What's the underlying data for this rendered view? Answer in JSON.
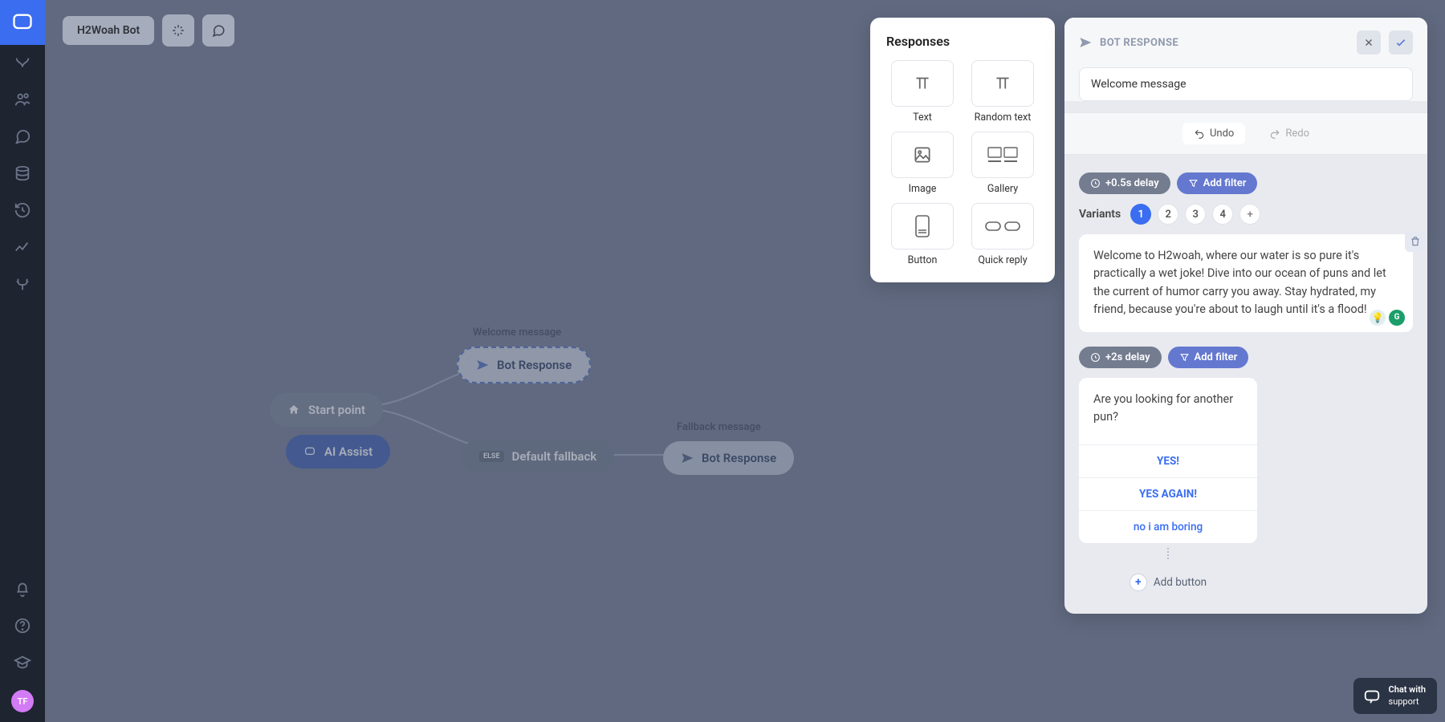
{
  "app": {
    "bot_name": "H2Woah Bot"
  },
  "sidebar": {
    "avatar_initials": "TF"
  },
  "canvas": {
    "start_label": "Start point",
    "ai_label": "AI Assist",
    "welcome_title": "Welcome message",
    "bot_response_label": "Bot Response",
    "fallback_title": "Fallback message",
    "default_fallback_label": "Default fallback",
    "else_badge": "ELSE"
  },
  "responses": {
    "title": "Responses",
    "items": {
      "text": "Text",
      "random_text": "Random text",
      "image": "Image",
      "gallery": "Gallery",
      "button": "Button",
      "quick_reply": "Quick reply"
    }
  },
  "panel": {
    "header_title": "BOT RESPONSE",
    "name_value": "Welcome message",
    "undo": "Undo",
    "redo": "Redo",
    "delay1": "+0.5s delay",
    "delay2": "+2s delay",
    "add_filter": "Add filter",
    "variants_label": "Variants",
    "variants": {
      "v1": "1",
      "v2": "2",
      "v3": "3",
      "v4": "4"
    },
    "message1": "Welcome to H2woah, where our water is so pure it's practically a wet joke! Dive into our ocean of puns and let the current of humor carry you away. Stay hydrated, my friend, because you're about to laugh until it's a flood!",
    "quick_text": "Are you looking for another pun?",
    "quick_btns": {
      "b1": "YES!",
      "b2": "YES AGAIN!",
      "b3": "no i am boring"
    },
    "add_button": "Add button"
  },
  "chat_widget": {
    "line1": "Chat with",
    "line2": "support"
  }
}
